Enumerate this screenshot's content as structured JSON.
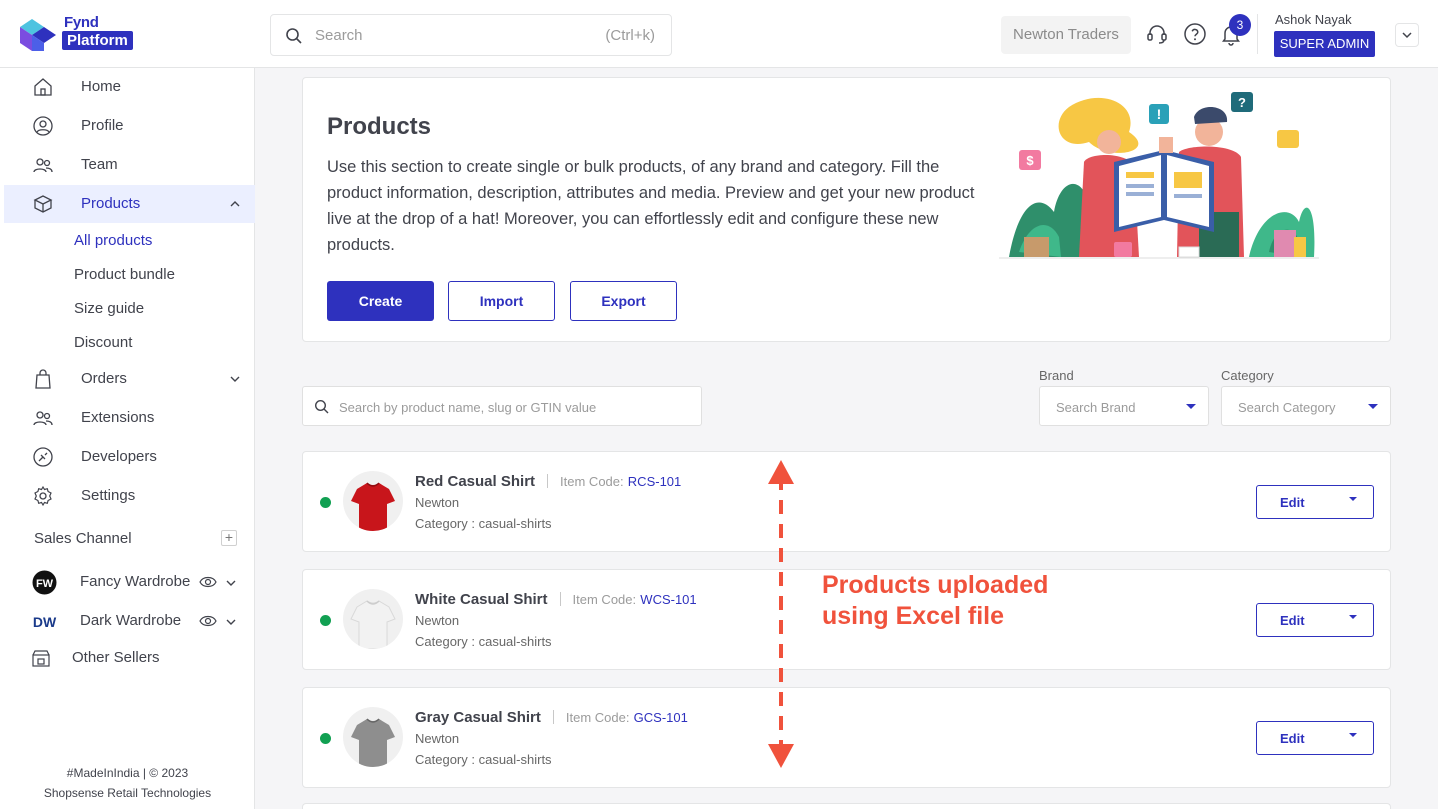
{
  "header": {
    "brand_top": "Fynd",
    "brand_bottom": "Platform",
    "search_placeholder": "Search",
    "search_shortcut": "(Ctrl+k)",
    "company": "Newton Traders",
    "notification_count": "3",
    "user_name": "Ashok Nayak",
    "user_role": "SUPER ADMIN"
  },
  "sidebar": {
    "items": [
      {
        "label": "Home",
        "icon": "home-icon"
      },
      {
        "label": "Profile",
        "icon": "profile-icon"
      },
      {
        "label": "Team",
        "icon": "team-icon"
      },
      {
        "label": "Products",
        "icon": "box-icon"
      },
      {
        "label": "Orders",
        "icon": "bag-icon"
      },
      {
        "label": "Extensions",
        "icon": "extensions-icon"
      },
      {
        "label": "Developers",
        "icon": "developers-icon"
      },
      {
        "label": "Settings",
        "icon": "gear-icon"
      }
    ],
    "product_subitems": [
      "All products",
      "Product bundle",
      "Size guide",
      "Discount"
    ],
    "sales_channel_title": "Sales Channel",
    "channels": [
      {
        "label": "Fancy Wardrobe",
        "logo_text": "FW"
      },
      {
        "label": "Dark Wardrobe",
        "logo_text": "DW"
      },
      {
        "label": "Other Sellers"
      }
    ],
    "footer_line1": "#MadeInIndia | © 2023",
    "footer_line2": "Shopsense Retail Technologies"
  },
  "intro": {
    "title": "Products",
    "description": "Use this section to create single or bulk products, of any brand and category. Fill the product information, description, attributes and media. Preview and get your new product live at the drop of a hat! Moreover, you can effortlessly edit and configure these new products.",
    "create_label": "Create",
    "import_label": "Import",
    "export_label": "Export"
  },
  "filters": {
    "search_placeholder": "Search by product name, slug or GTIN value",
    "brand_label": "Brand",
    "brand_placeholder": "Search Brand",
    "category_label": "Category",
    "category_placeholder": "Search Category"
  },
  "products": [
    {
      "name": "Red Casual Shirt",
      "code_label": "Item Code:",
      "code": "RCS-101",
      "brand": "Newton",
      "category": "Category : casual-shirts",
      "color": "#c8151b",
      "edit_label": "Edit"
    },
    {
      "name": "White Casual Shirt",
      "code_label": "Item Code:",
      "code": "WCS-101",
      "brand": "Newton",
      "category": "Category : casual-shirts",
      "color": "#f2f2f2",
      "edit_label": "Edit"
    },
    {
      "name": "Gray Casual Shirt",
      "code_label": "Item Code:",
      "code": "GCS-101",
      "brand": "Newton",
      "category": "Category : casual-shirts",
      "color": "#8e8e8e",
      "edit_label": "Edit"
    }
  ],
  "annotation": {
    "line1": "Products uploaded",
    "line2": "using Excel file"
  },
  "colors": {
    "accent": "#2e31be",
    "status_active": "#11a052",
    "annotation": "#f0523c"
  }
}
